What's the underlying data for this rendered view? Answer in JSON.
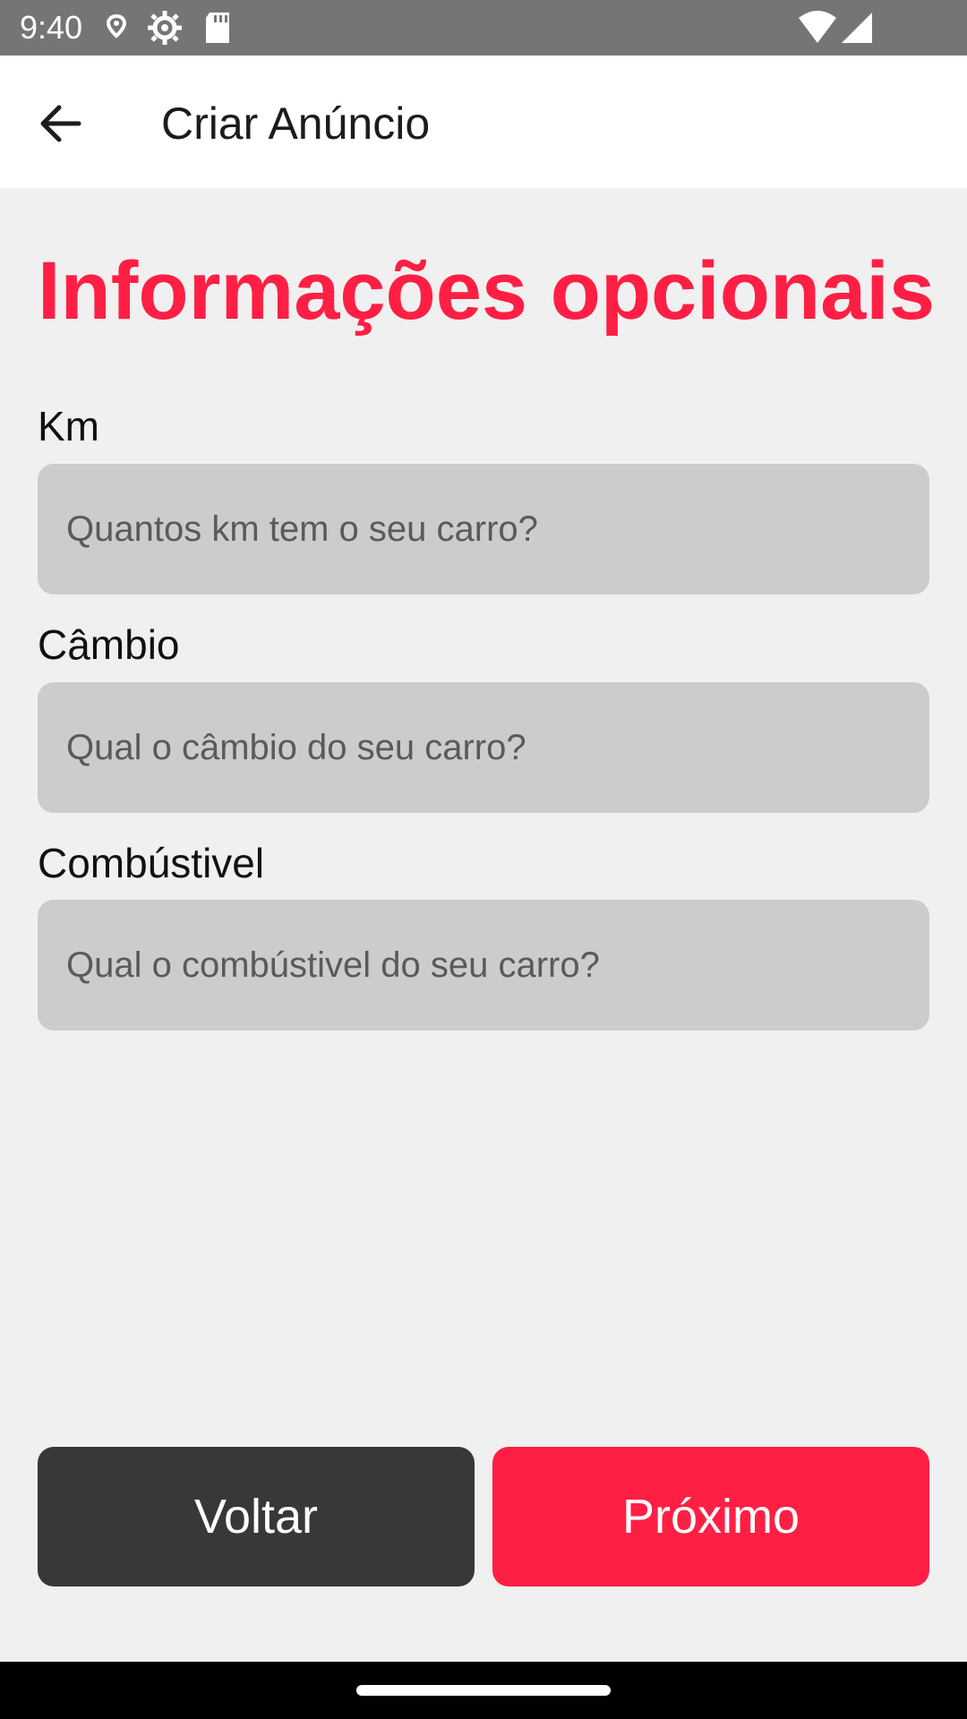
{
  "status_bar": {
    "time": "9:40",
    "icons_left": [
      "location-icon",
      "settings-icon",
      "sd-card-icon"
    ],
    "icons_right": [
      "wifi-icon",
      "signal-icon"
    ]
  },
  "app_bar": {
    "back_icon": "back-arrow-icon",
    "title": "Criar Anúncio"
  },
  "page": {
    "heading": "Informações opcionais",
    "accent_color": "#ff1f44"
  },
  "form": {
    "km": {
      "label": "Km",
      "placeholder": "Quantos km tem o seu carro?",
      "value": ""
    },
    "cambio": {
      "label": "Câmbio",
      "placeholder": "Qual o câmbio do seu carro?",
      "value": ""
    },
    "combustivel": {
      "label": "Combústivel",
      "placeholder": "Qual o combústivel do seu carro?",
      "value": ""
    }
  },
  "actions": {
    "back_label": "Voltar",
    "next_label": "Próximo",
    "back_color": "#383838",
    "next_color": "#ff1f44"
  }
}
